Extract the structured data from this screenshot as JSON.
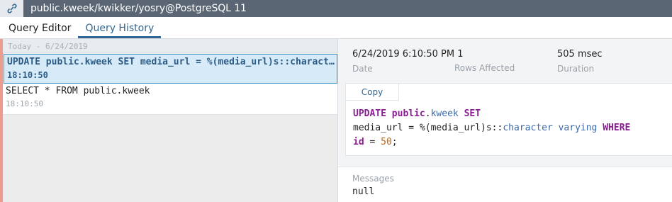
{
  "titlebar": {
    "title": "public.kweek/kwikker/yosry@PostgreSQL 11",
    "icon": "connection-icon"
  },
  "tabs": [
    {
      "label": "Query Editor",
      "active": false
    },
    {
      "label": "Query History",
      "active": true
    }
  ],
  "history": {
    "group_label": "Today - 6/24/2019",
    "entries": [
      {
        "query": "UPDATE public.kweek SET media_url = %(media_url)s::character varying WHERE id = 50;",
        "time": "18:10:50",
        "selected": true
      },
      {
        "query": "SELECT * FROM public.kweek",
        "time": "18:10:50",
        "selected": false
      }
    ]
  },
  "details": {
    "date_value": "6/24/2019 6:10:50 PM",
    "date_label": "Date",
    "rows_value": "1",
    "rows_label": "Rows Affected",
    "duration_value": "505 msec",
    "duration_label": "Duration",
    "copy_label": "Copy",
    "sql_tokens": {
      "update": "UPDATE",
      "schema": "public",
      "dot": ".",
      "table": "kweek",
      "set": "SET",
      "line2a": "media_url = %(media_url)s::",
      "type": "character varying",
      "where": "WHERE",
      "line3a": "id = ",
      "num": "50",
      "semi": ";"
    },
    "messages_label": "Messages",
    "messages_value": "null"
  },
  "colors": {
    "accent": "#326690",
    "titlebar": "#5b6674",
    "left_marker": "#ec9b8f",
    "selected_bg": "#d6ebf7"
  }
}
